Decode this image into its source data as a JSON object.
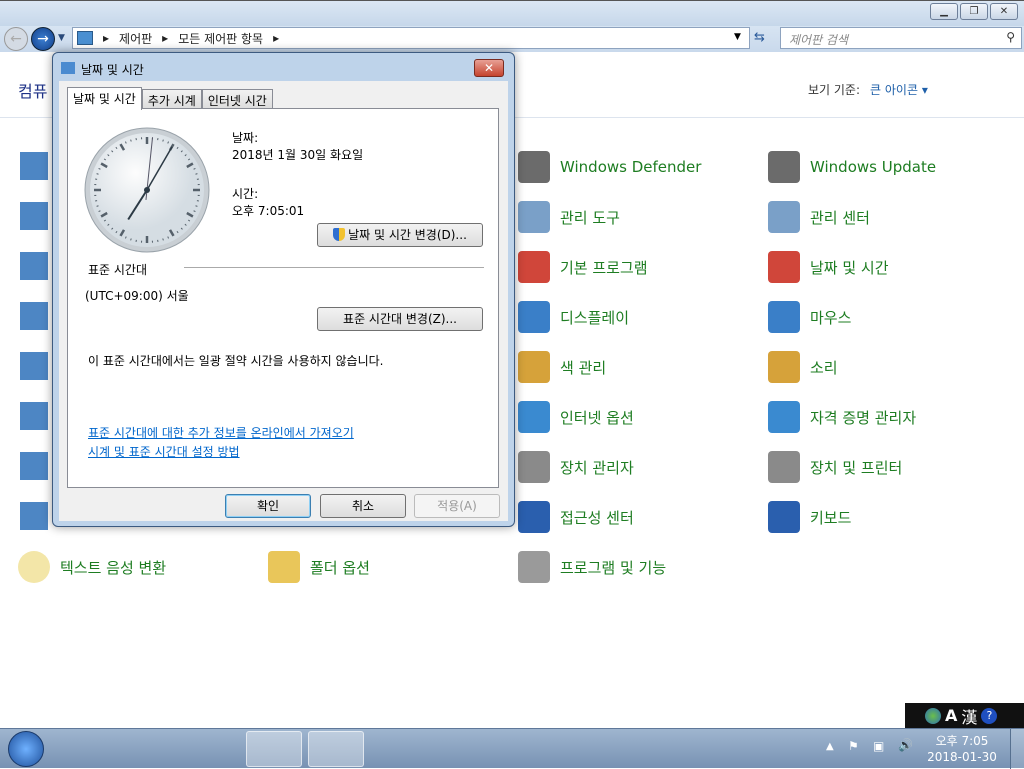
{
  "window": {
    "buttons": [
      "minimize",
      "maximize",
      "close"
    ]
  },
  "nav": {
    "breadcrumb": [
      "제어판",
      "모든 제어판 항목"
    ],
    "search_placeholder": "제어판 검색"
  },
  "header": {
    "title": "컴퓨",
    "view_by_label": "보기 기준:",
    "view_by_value": "큰 아이콘"
  },
  "items": {
    "col3": [
      "Windows Defender",
      "관리 도구",
      "기본 프로그램",
      "디스플레이",
      "색 관리",
      "인터넷 옵션",
      "장치 관리자",
      "접근성 센터",
      "프로그램 및 기능"
    ],
    "col4": [
      "Windows Update",
      "관리 센터",
      "날짜 및 시간",
      "마우스",
      "소리",
      "자격 증명 관리자",
      "장치 및 프린터",
      "키보드"
    ],
    "col1_last": "텍스트 음성 변환",
    "col2_last": "폴더 옵션"
  },
  "dialog": {
    "title": "날짜 및 시간",
    "tabs": [
      "날짜 및 시간",
      "추가 시계",
      "인터넷 시간"
    ],
    "date_label": "날짜:",
    "date_value": "2018년 1월 30일 화요일",
    "time_label": "시간:",
    "time_value": "오후 7:05:01",
    "change_datetime_button": "날짜 및 시간 변경(D)...",
    "timezone_heading": "표준 시간대",
    "timezone_value": "(UTC+09:00) 서울",
    "change_timezone_button": "표준 시간대 변경(Z)...",
    "dst_note": "이 표준 시간대에서는 일광 절약 시간을 사용하지 않습니다.",
    "link_more_info": "표준 시간대에 대한 추가 정보를 온라인에서 가져오기",
    "link_howto": "시계 및 표준 시간대 설정 방법",
    "ok": "확인",
    "cancel": "취소",
    "apply": "적용(A)",
    "clock": {
      "hour": 7,
      "minute": 5,
      "second": 1
    }
  },
  "ime": {
    "mode": "A",
    "hanja": "漢"
  },
  "tray": {
    "time": "오후 7:05",
    "date": "2018-01-30"
  }
}
